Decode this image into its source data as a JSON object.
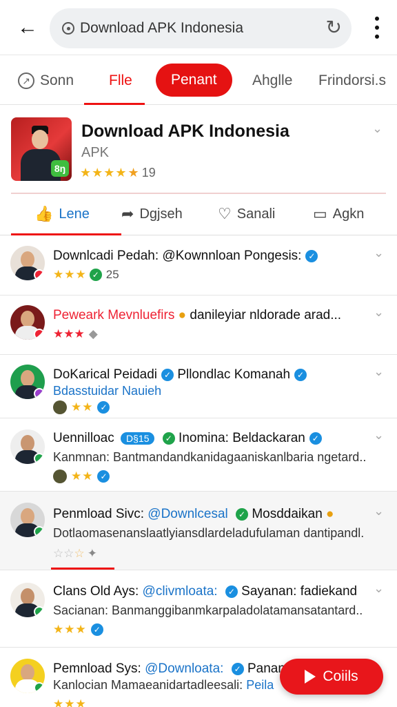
{
  "browser": {
    "url": "Download APK Indonesia"
  },
  "category_tabs": [
    "Sonn",
    "Flle",
    "Penant",
    "Ahglle",
    "Frindorsi.s"
  ],
  "app": {
    "title": "Download APK Indonesia",
    "subtitle": "APK",
    "stars": "★★★★",
    "rating_count": "19",
    "icon_badge": "8ŋ"
  },
  "action_tabs": [
    "Lene",
    "Dgjseh",
    "Sanali",
    "Agkn"
  ],
  "posts": [
    {
      "line1": "Downlcadi Pedah: @Kownnloan Pongesis:",
      "stars": "★★★",
      "count": "25"
    },
    {
      "line1": "Peweark Mevnluefirs",
      "line1b": "danileyiar nldorade arad...",
      "stars": "★★★"
    },
    {
      "line1": "DoKarical Peidadi",
      "line1b": "Pllondlac Komanah",
      "line2": "Bdasstuidar Nauieh",
      "stars": "★★"
    },
    {
      "line1": "Uennilloac",
      "tag": "D§15",
      "line1b": "Inomina: Beldackaran",
      "line2": "Kanmnan: Bantmandandkanidagaaniskanlbaria ngetard..",
      "stars": "★★"
    },
    {
      "line1": "Penmload Sivc:",
      "handle": "@Downlcesal",
      "line1b": "Mosddaikan",
      "line2": "Dotlaomasenanslaatlyiansdlardeladufulaman dantipandl.",
      "stars": "☆☆"
    },
    {
      "line1": "Clans Old Ays:",
      "handle": "@clivmloata:",
      "line1b": "Sayanan: fadiekand",
      "line2": "Sacianan: Banmanggibanmkarpaladolatamansatantard..",
      "stars": "★★★"
    },
    {
      "line1": "Pemnload Sys:",
      "handle": "@Downloata:",
      "line1b": "Panann",
      "line2": "Kanlocian Mamaeanidartadleesali:",
      "line2b": "Peila",
      "stars": "★★★"
    }
  ],
  "fab": {
    "label": "Coiils"
  },
  "colors": {
    "accent": "#e51212",
    "verified": "#1a8fe0",
    "star": "#f3b418"
  }
}
